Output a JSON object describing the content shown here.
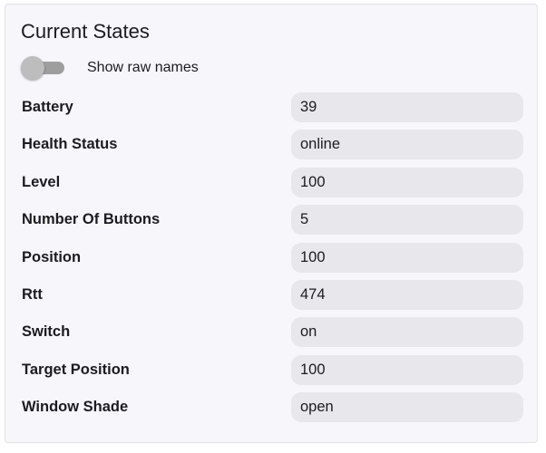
{
  "panel": {
    "title": "Current States",
    "toggle": {
      "label": "Show raw names",
      "checked": false
    }
  },
  "states": [
    {
      "name": "Battery",
      "value": "39"
    },
    {
      "name": "Health Status",
      "value": "online"
    },
    {
      "name": "Level",
      "value": "100"
    },
    {
      "name": "Number Of Buttons",
      "value": "5"
    },
    {
      "name": "Position",
      "value": "100"
    },
    {
      "name": "Rtt",
      "value": "474"
    },
    {
      "name": "Switch",
      "value": "on"
    },
    {
      "name": "Target Position",
      "value": "100"
    },
    {
      "name": "Window Shade",
      "value": "open"
    }
  ]
}
